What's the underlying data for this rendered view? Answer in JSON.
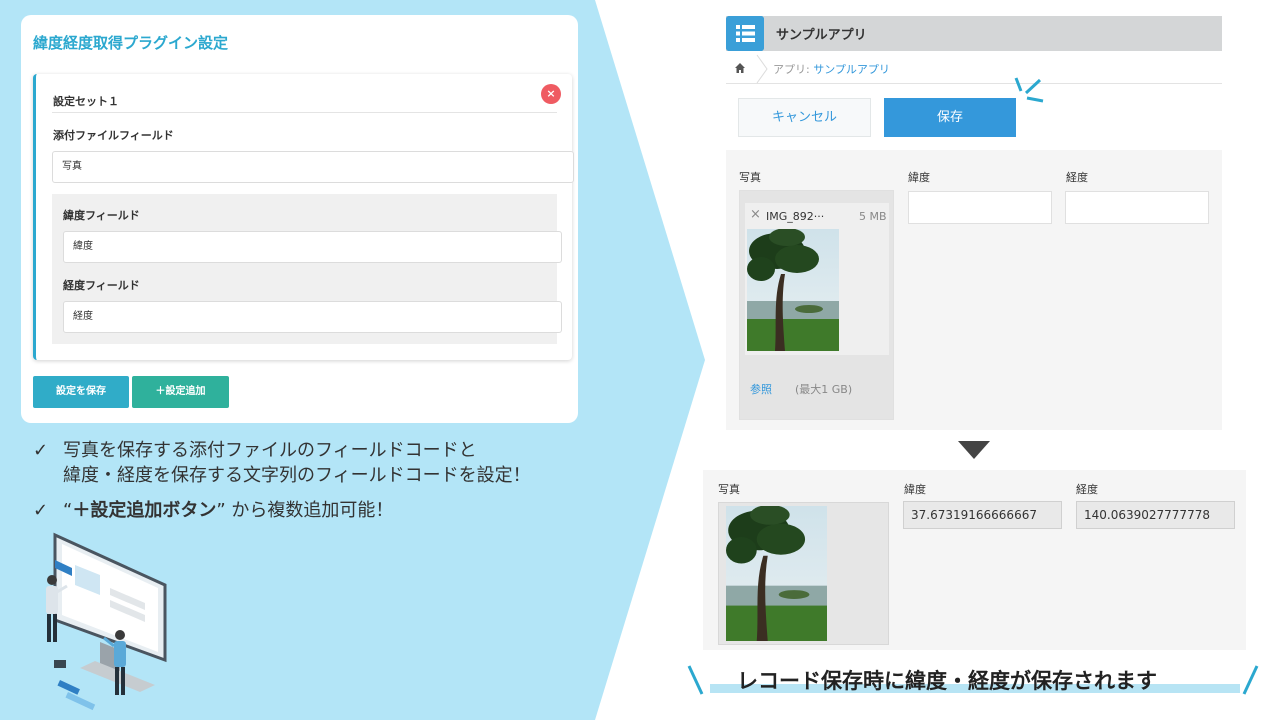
{
  "settings": {
    "title": "緯度経度取得プラグイン設定",
    "set_title": "設定セット１",
    "close_symbol": "×",
    "attachment_label": "添付ファイルフィールド",
    "attachment_value": "写真",
    "latitude_label": "緯度フィールド",
    "latitude_value": "緯度",
    "longitude_label": "経度フィールド",
    "longitude_value": "経度",
    "save_button": "設定を保存",
    "add_button": "＋設定追加"
  },
  "bullets": {
    "check": "✓",
    "line1a": "写真を保存する添付ファイルのフィールドコードと",
    "line1b": "緯度・経度を保存する文字列のフィールドコードを設定！",
    "line2_open": "“",
    "line2_bold": "＋設定追加ボタン",
    "line2_close": "” から複数追加可能！"
  },
  "app": {
    "name": "サンプルアプリ",
    "breadcrumb_prefix": "アプリ: ",
    "breadcrumb_link": "サンプルアプリ",
    "cancel_button": "キャンセル",
    "save_button": "保存",
    "fields": {
      "photo_label": "写真",
      "latitude_label": "緯度",
      "longitude_label": "経度"
    },
    "file": {
      "name": "IMG_892···",
      "size": "5 MB",
      "remove_symbol": "×"
    },
    "browse_link": "参照",
    "max_size": "(最大1 GB)"
  },
  "result": {
    "photo_label": "写真",
    "latitude_label": "緯度",
    "longitude_label": "経度",
    "latitude_value": "37.67319166666667",
    "longitude_value": "140.0639027777778"
  },
  "caption": "レコード保存時に緯度・経度が保存されます",
  "colors": {
    "light_blue_bg": "#b3e5f7",
    "accent_cyan": "#2ba8cf",
    "kintone_blue": "#3498db",
    "close_red": "#ef5b62",
    "add_green": "#2fb19c"
  },
  "icons": [
    "close-icon",
    "check-icon",
    "app-list-icon",
    "home-icon",
    "remove-file-icon",
    "down-triangle-icon",
    "sparkle-icon"
  ]
}
